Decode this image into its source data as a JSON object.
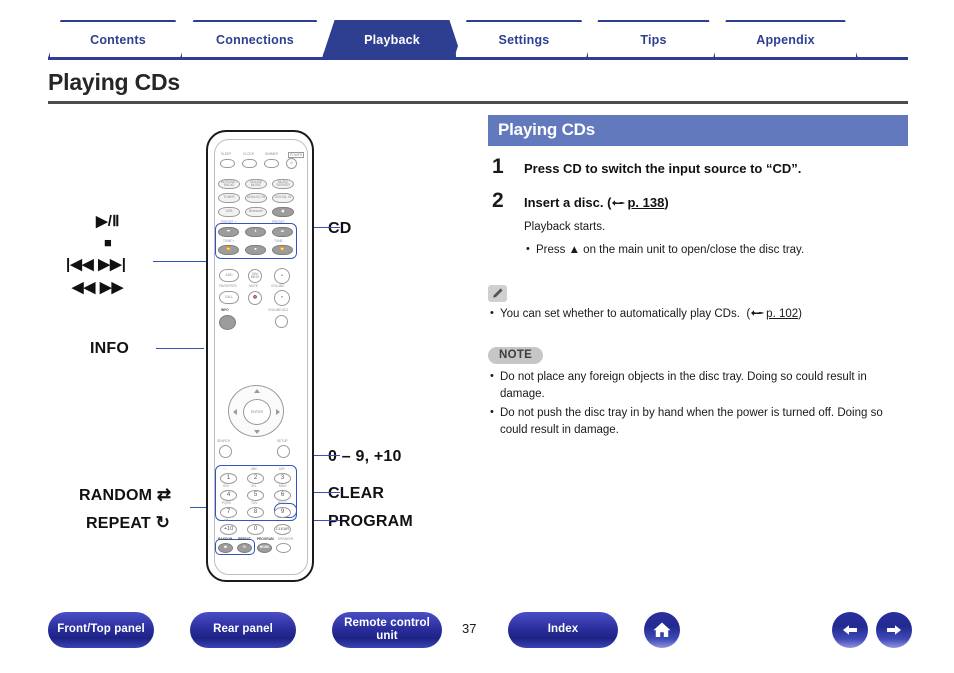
{
  "tabs": [
    {
      "label": "Contents",
      "active": false
    },
    {
      "label": "Connections",
      "active": false
    },
    {
      "label": "Playback",
      "active": true
    },
    {
      "label": "Settings",
      "active": false
    },
    {
      "label": "Tips",
      "active": false
    },
    {
      "label": "Appendix",
      "active": false
    }
  ],
  "page_title": "Playing CDs",
  "content": {
    "section_header": "Playing CDs",
    "steps": [
      {
        "num": "1",
        "title": "Press CD to switch the input source to “CD”.",
        "body": "",
        "ref": "",
        "bullets": []
      },
      {
        "num": "2",
        "title": "Insert a disc.",
        "ref": "p. 138",
        "body": "Playback starts.",
        "bullets": [
          "Press ▲ on the main unit to open/close the disc tray."
        ]
      }
    ],
    "memo": {
      "icon": "pencil-icon",
      "bullets": [
        "You can set whether to automatically play CDs."
      ],
      "ref": "p. 102"
    },
    "note": {
      "badge": "NOTE",
      "bullets": [
        "Do not place any foreign objects in the disc tray. Doing so could result in damage.",
        "Do not push the disc tray in by hand when the power is turned off. Doing so could result in damage."
      ]
    }
  },
  "figure": {
    "callouts": {
      "playpause": "▶/Ⅱ",
      "stop": "■",
      "skip": "|◀◀  ▶▶|",
      "scan": "◀◀  ▶▶",
      "info": "INFO",
      "cd": "CD",
      "numbers": "0 – 9, +10",
      "clear": "CLEAR",
      "program": "PROGRAM",
      "random": "RANDOM",
      "repeat": "REPEAT"
    },
    "remote": {
      "top_labels": [
        "SLEEP",
        "CLOCK",
        "DIMMER",
        "POWER"
      ],
      "source_row1": [
        "INTERNET RADIO",
        "ONLINE MUSIC",
        "MUSIC SERVER"
      ],
      "source_row2": [
        "TUNER",
        "ANALOG IN",
        "DIGITAL IN"
      ],
      "source_row3": [
        "USB",
        "Bluetooth",
        "CD"
      ],
      "transport_top": [
        "◀◀",
        "▶/Ⅱ",
        "▶▶"
      ],
      "transport_bottom": [
        "◀◀",
        "■",
        "▶▶"
      ],
      "tune_labels": [
        "TUNE +",
        "TUNE -"
      ],
      "func_labels": [
        "ADD",
        "DIMMER",
        "CALL",
        "FAVORITES",
        "MUTE",
        "VOLUME",
        "VOLUME ADJ"
      ],
      "info_label": "INFO",
      "enter_label": "ENTER",
      "search_label": "SEARCH",
      "setup_label": "SETUP",
      "keypad": [
        {
          "key": "1",
          "sub": ". / :"
        },
        {
          "key": "2",
          "sub": "ABC"
        },
        {
          "key": "3",
          "sub": "DEF"
        },
        {
          "key": "4",
          "sub": "GHI"
        },
        {
          "key": "5",
          "sub": "JKL"
        },
        {
          "key": "6",
          "sub": "MNO"
        },
        {
          "key": "7",
          "sub": "PQRS"
        },
        {
          "key": "8",
          "sub": "TUV"
        },
        {
          "key": "9",
          "sub": "WXYZ"
        },
        {
          "key": "+10",
          "sub": "a/A"
        },
        {
          "key": "0",
          "sub": "␣"
        },
        {
          "key": "CLEAR",
          "sub": ""
        }
      ],
      "bottom_labels": [
        "RANDOM",
        "REPEAT",
        "PROGRAM",
        "SPEAKER"
      ],
      "mode_label": "MODE"
    }
  },
  "footer": {
    "buttons": [
      {
        "label": "Front/Top panel",
        "name": "front-top-panel-button"
      },
      {
        "label": "Rear panel",
        "name": "rear-panel-button"
      },
      {
        "label": "Remote control unit",
        "name": "remote-control-unit-button"
      },
      {
        "label": "Index",
        "name": "index-button"
      }
    ],
    "page_number": "37",
    "home_icon": "home-icon",
    "prev_icon": "arrow-left-icon",
    "next_icon": "arrow-right-icon"
  },
  "colors": {
    "brand_navy": "#2e3f92",
    "section_blue": "#6379bd",
    "highlight_blue": "#3355bb",
    "rule_gray": "#4d4d4d"
  }
}
